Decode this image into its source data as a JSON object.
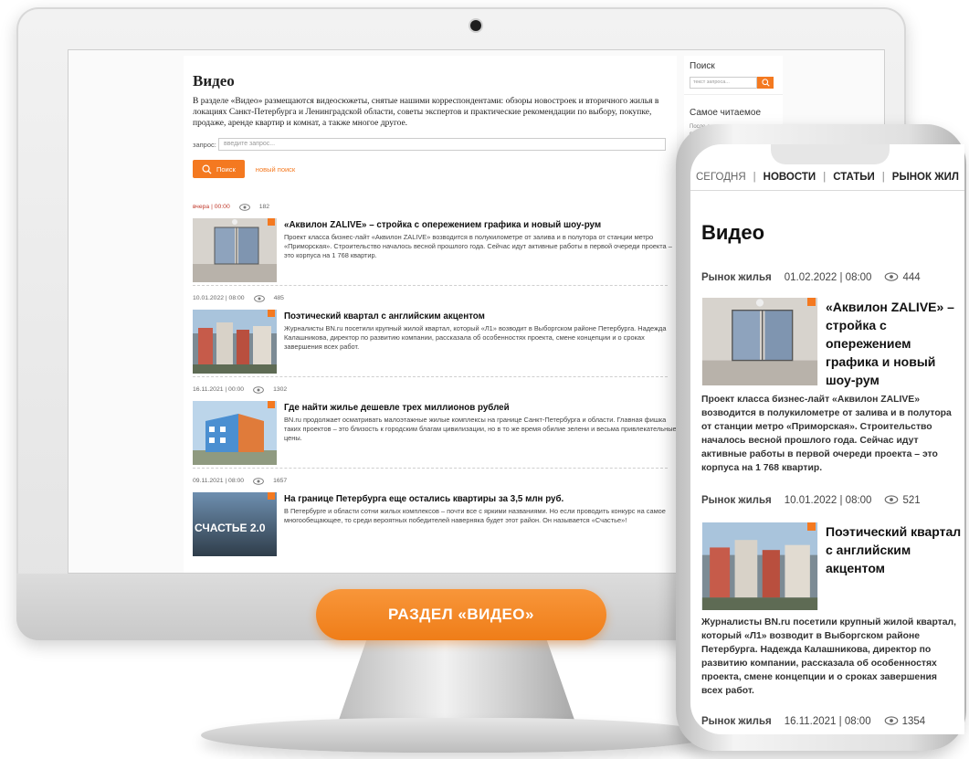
{
  "desktop": {
    "page_title": "Видео",
    "intro": "В разделе «Видео» размещаются видеосюжеты, снятые нашими корреспондентами: обзоры новостроек и вторичного жилья в локациях Санкт-Петербурга и Ленинградской области, советы экспертов и практические рекомендации по выбору, покупке, продаже, аренде квартир и комнат, а также многое другое.",
    "query_label": "запрос:",
    "query_placeholder": "введите запрос...",
    "search_button": "Поиск",
    "new_search_link": "новый поиск",
    "articles": [
      {
        "date": "вчера | 00:00",
        "views": "182",
        "title": "«Аквилон ZALIVE» – стройка с опережением графика и новый шоу-рум",
        "text": "Проект класса бизнес-лайт «Аквилон ZALIVE» возводится в полукилометре от залива и в полутора от станции метро «Приморская». Строительство началось весной прошлого года. Сейчас идут активные работы в первой очереди проекта – это корпуса на 1 768 квартир."
      },
      {
        "date": "10.01.2022 | 08:00",
        "views": "485",
        "title": "Поэтический квартал с английским акцентом",
        "text": "Журналисты BN.ru посетили крупный жилой квартал, который «Л1» возводит в Выборгском районе Петербурга. Надежда Калашникова, директор по развитию компании, рассказала об особенностях проекта, смене концепции и о сроках завершения всех работ."
      },
      {
        "date": "16.11.2021 | 00:00",
        "views": "1302",
        "title": "Где найти жилье дешевле трех миллионов рублей",
        "text": "BN.ru продолжает осматривать малоэтажные жилые комплексы на границе Санкт-Петербурга и области. Главная фишка таких проектов – это близость к городским благам цивилизации, но в то же время обилие зелени и весьма привлекательные цены."
      },
      {
        "date": "09.11.2021 | 08:00",
        "views": "1657",
        "title": "На границе Петербурга еще остались квартиры за 3,5 млн руб.",
        "text": "В Петербурге и области сотни жилых комплексов – почти все с яркими названиями. Но если проводить конкурс на самое многообещающее, то среди вероятных победителей наверняка будет этот район. Он называется «Счастье»!"
      }
    ],
    "thumb4_text": "СЧАСТЬЕ 2.0"
  },
  "sidebar": {
    "search_title": "Поиск",
    "search_placeholder": "текст запроса...",
    "popular_title": "Самое читаемое",
    "popular_snippet": "После отмены налога семейн... став..."
  },
  "banner": "РАЗДЕЛ «ВИДЕО»",
  "mobile": {
    "nav": [
      "СЕГОДНЯ",
      "НОВОСТИ",
      "СТАТЬИ",
      "РЫНОК ЖИЛ"
    ],
    "nav_sep": "|",
    "title": "Видео",
    "articles": [
      {
        "category": "Рынок жилья",
        "date": "01.02.2022 | 08:00",
        "views": "444",
        "title": "«Аквилон ZALIVE» – стройка с опережением графика и новый шоу-рум",
        "text": "Проект класса бизнес-лайт «Аквилон ZALIVE» возводится в полукилометре от залива и в полутора от станции метро «Приморская». Строительство началось весной прошлого года. Сейчас идут активные работы в первой очереди проекта – это корпуса на 1 768 квартир."
      },
      {
        "category": "Рынок жилья",
        "date": "10.01.2022 | 08:00",
        "views": "521",
        "title": "Поэтический квартал с английским акцентом",
        "text": "Журналисты BN.ru посетили крупный жилой квартал, который «Л1» возводит в Выборгском районе Петербурга. Надежда Калашникова, директор по развитию компании, рассказала об особенностях проекта, смене концепции и о сроках завершения всех работ."
      },
      {
        "category": "Рынок жилья",
        "date": "16.11.2021 | 08:00",
        "views": "1354"
      }
    ]
  },
  "colors": {
    "accent": "#f47920",
    "pill": "#ef7d18"
  }
}
